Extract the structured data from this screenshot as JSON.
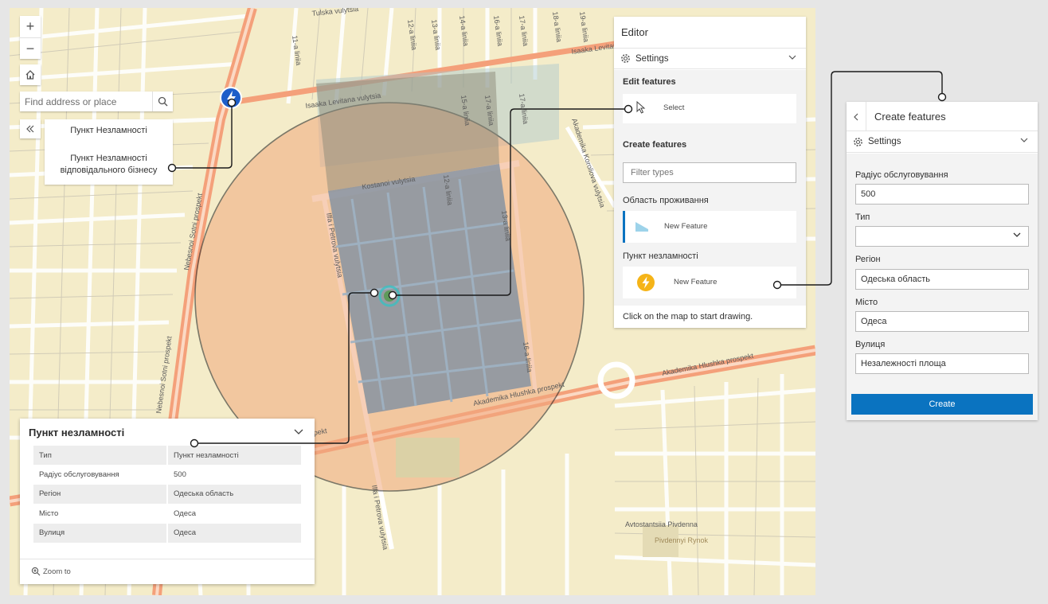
{
  "map": {
    "zoom_in": "+",
    "zoom_out": "−",
    "search_placeholder": "Find address or place",
    "legend": {
      "item1": "Пункт Незламності",
      "item2_line1": "Пункт Незламності",
      "item2_line2": "відповідального бізнесу"
    },
    "streets": [
      "Isaaka Levitana vulytsia",
      "Isaaka Levitana vulytsia",
      "Kostanoi vulytsia",
      "Ilfa i Petrova vulytsia",
      "Ilfa i Petrova vulytsia",
      "Akademika Koroliova vulytsia",
      "Akademika Hlushka prospekt",
      "Akademika Hlushka prospekt",
      "Nebesnoi Sotni prospekt",
      "Nebesnoi Sotni prospekt",
      "prospekt",
      "Tulska vulytsia",
      "11-a liniia",
      "12-a liniia",
      "13-a liniia",
      "14-a liniia",
      "16-a liniia",
      "17-a liniia",
      "18-a liniia",
      "19-a liniia",
      "12-a liniia",
      "13-a liniia",
      "16-a liniia",
      "17-a liniia",
      "17-a liniia",
      "15-a liniia",
      "Avtostantsiia Pivdenna",
      "Pivdennyi Rynok"
    ],
    "colors": {
      "buffer_fill": "#f2a97e",
      "buffer_area": "#7b8ea6",
      "accent_point": "#1d5ec9"
    }
  },
  "popup": {
    "title": "Пункт незламності",
    "rows": [
      {
        "field": "Тип",
        "value": "Пункт незламності"
      },
      {
        "field": "Радіус обслуговування",
        "value": "500"
      },
      {
        "field": "Регіон",
        "value": "Одеська область"
      },
      {
        "field": "Місто",
        "value": "Одеса"
      },
      {
        "field": "Вулиця",
        "value": "Одеса"
      }
    ],
    "zoom_to": "Zoom to"
  },
  "editor": {
    "title": "Editor",
    "settings": "Settings",
    "edit_features": "Edit features",
    "select": "Select",
    "create_features": "Create features",
    "filter_placeholder": "Filter types",
    "layer1": "Область проживання",
    "layer1_feature": "New Feature",
    "layer2": "Пункт незламності",
    "layer2_feature": "New Feature",
    "hint": "Click on the map to start drawing."
  },
  "create": {
    "title": "Create features",
    "settings": "Settings",
    "fields": [
      {
        "label": "Радіус обслуговування",
        "value": "500"
      },
      {
        "label": "Тип",
        "value": ""
      },
      {
        "label": "Регіон",
        "value": "Одеська область"
      },
      {
        "label": "Місто",
        "value": "Одеса"
      },
      {
        "label": "Вулиця",
        "value": "Незалежності площа"
      }
    ],
    "button": "Create"
  }
}
